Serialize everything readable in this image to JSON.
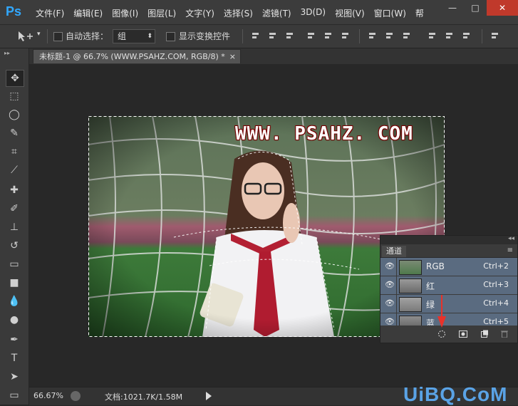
{
  "app": {
    "logo": "Ps"
  },
  "menu": [
    "文件(F)",
    "编辑(E)",
    "图像(I)",
    "图层(L)",
    "文字(Y)",
    "选择(S)",
    "滤镜(T)",
    "3D(D)",
    "视图(V)",
    "窗口(W)",
    "帮"
  ],
  "window_controls": {
    "minimize": "—",
    "restore": "□",
    "close": "✕"
  },
  "options_bar": {
    "auto_select_label": "自动选择：",
    "auto_select_value": "组",
    "show_transform_label": "显示变换控件"
  },
  "document_tab": {
    "title": "未标题-1 @ 66.7% (WWW.PSAHZ.COM, RGB/8) *",
    "close": "×"
  },
  "canvas": {
    "watermark_text": "WWW. PSAHZ. COM"
  },
  "status_bar": {
    "zoom": "66.67%",
    "doc_info": "文档:1021.7K/1.58M"
  },
  "channels_panel": {
    "tab": "通道",
    "collapse": "◂◂",
    "menu": "≡",
    "channels": [
      {
        "name": "RGB",
        "shortcut": "Ctrl+2"
      },
      {
        "name": "红",
        "shortcut": "Ctrl+3"
      },
      {
        "name": "绿",
        "shortcut": "Ctrl+4"
      },
      {
        "name": "蓝",
        "shortcut": "Ctrl+5"
      }
    ]
  },
  "site_watermark": "UiBQ.CoM",
  "colors": {
    "ps_blue": "#31a8ff",
    "panel_selected": "#5a6b80",
    "arrow": "#e8322a",
    "watermark_red": "#7a0000"
  }
}
